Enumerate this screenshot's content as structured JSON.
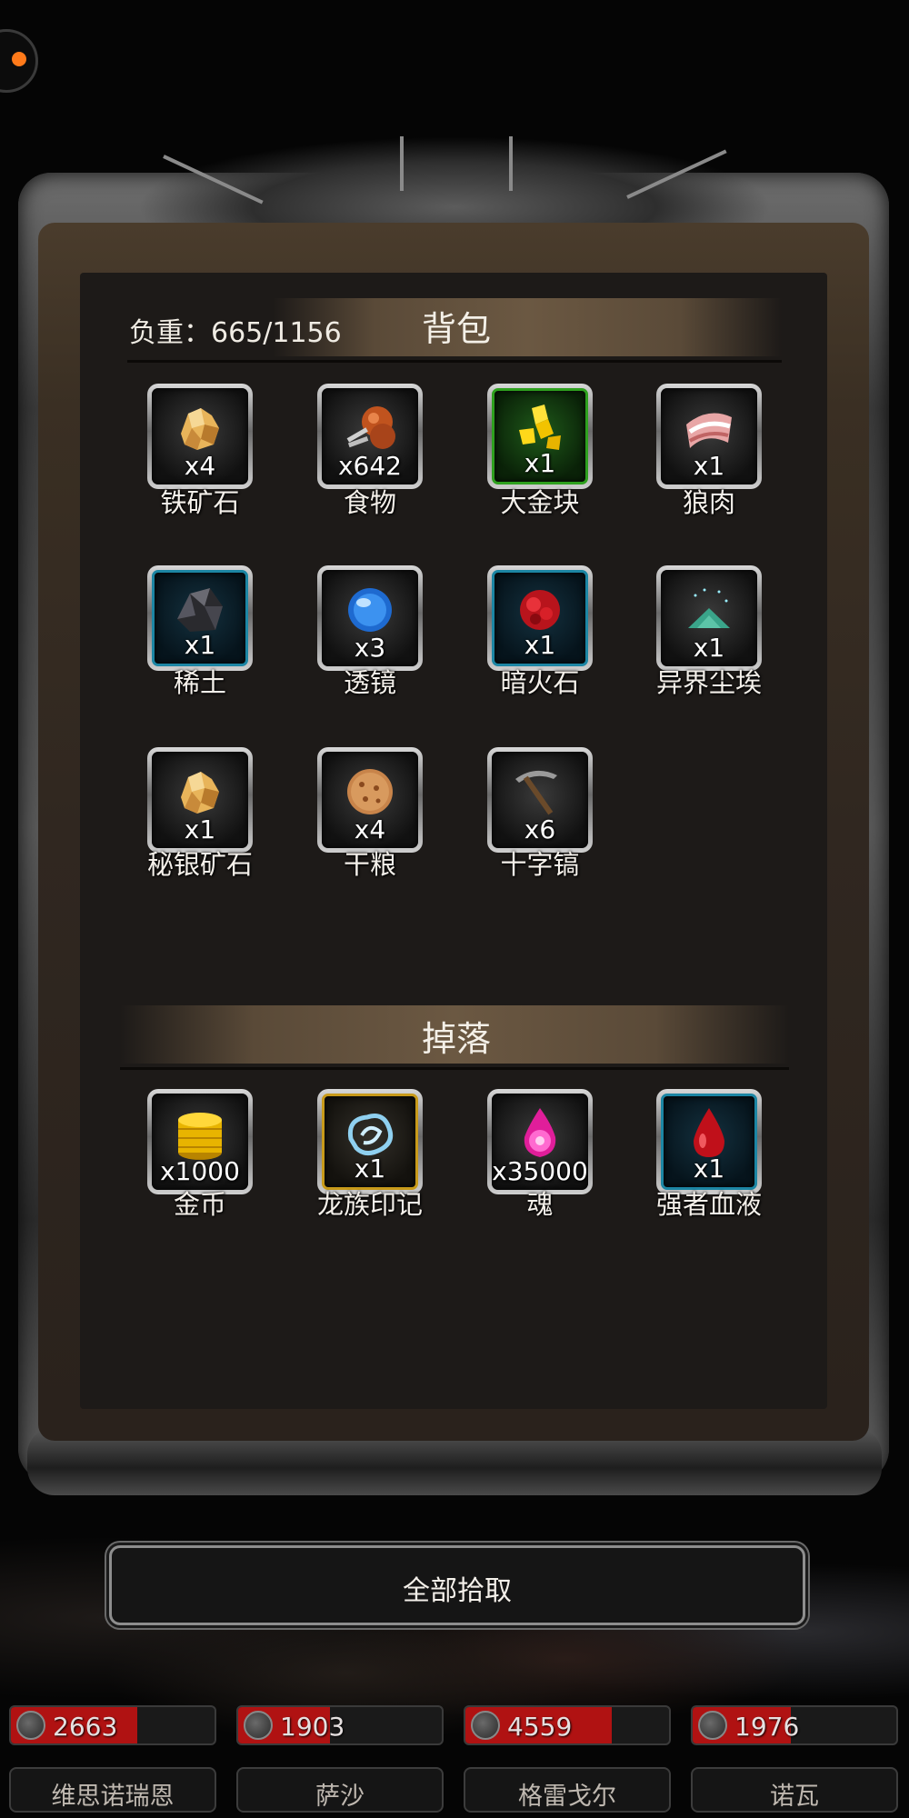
{
  "header": {
    "weight_label": "负重：665/1156"
  },
  "backpack": {
    "title": "背包",
    "items": [
      {
        "name": "铁矿石",
        "qty": "x4",
        "icon": "ore-icon",
        "rarity": "gray"
      },
      {
        "name": "食物",
        "qty": "x642",
        "icon": "meat-leg-icon",
        "rarity": "gray"
      },
      {
        "name": "大金块",
        "qty": "x1",
        "icon": "gold-nugget-icon",
        "rarity": "green"
      },
      {
        "name": "狼肉",
        "qty": "x1",
        "icon": "bacon-icon",
        "rarity": "gray"
      },
      {
        "name": "稀土",
        "qty": "x1",
        "icon": "black-rock-icon",
        "rarity": "blue"
      },
      {
        "name": "透镜",
        "qty": "x3",
        "icon": "blue-orb-icon",
        "rarity": "gray"
      },
      {
        "name": "暗火石",
        "qty": "x1",
        "icon": "red-stone-icon",
        "rarity": "blue"
      },
      {
        "name": "异界尘埃",
        "qty": "x1",
        "icon": "dust-pile-icon",
        "rarity": "gray"
      },
      {
        "name": "秘银矿石",
        "qty": "x1",
        "icon": "ore-icon",
        "rarity": "gray"
      },
      {
        "name": "干粮",
        "qty": "x4",
        "icon": "cookie-icon",
        "rarity": "gray"
      },
      {
        "name": "十字镐",
        "qty": "x6",
        "icon": "pickaxe-icon",
        "rarity": "gray"
      }
    ]
  },
  "drops": {
    "title": "掉落",
    "items": [
      {
        "name": "金币",
        "qty": "x1000",
        "icon": "gold-coins-icon",
        "rarity": "gray"
      },
      {
        "name": "龙族印记",
        "qty": "x1",
        "icon": "dragon-sigil-icon",
        "rarity": "gold"
      },
      {
        "name": "魂",
        "qty": "x35000",
        "icon": "soul-flame-icon",
        "rarity": "gray"
      },
      {
        "name": "强者血液",
        "qty": "x1",
        "icon": "blood-drop-icon",
        "rarity": "blue"
      }
    ]
  },
  "actions": {
    "pickup_all_label": "全部拾取"
  },
  "party": [
    {
      "name": "维思诺瑞恩",
      "hp": "2663",
      "hp_fill": 0.62
    },
    {
      "name": "萨沙",
      "hp": "1903",
      "hp_fill": 0.45
    },
    {
      "name": "格雷戈尔",
      "hp": "4559",
      "hp_fill": 0.72
    },
    {
      "name": "诺瓦",
      "hp": "1976",
      "hp_fill": 0.48
    }
  ]
}
